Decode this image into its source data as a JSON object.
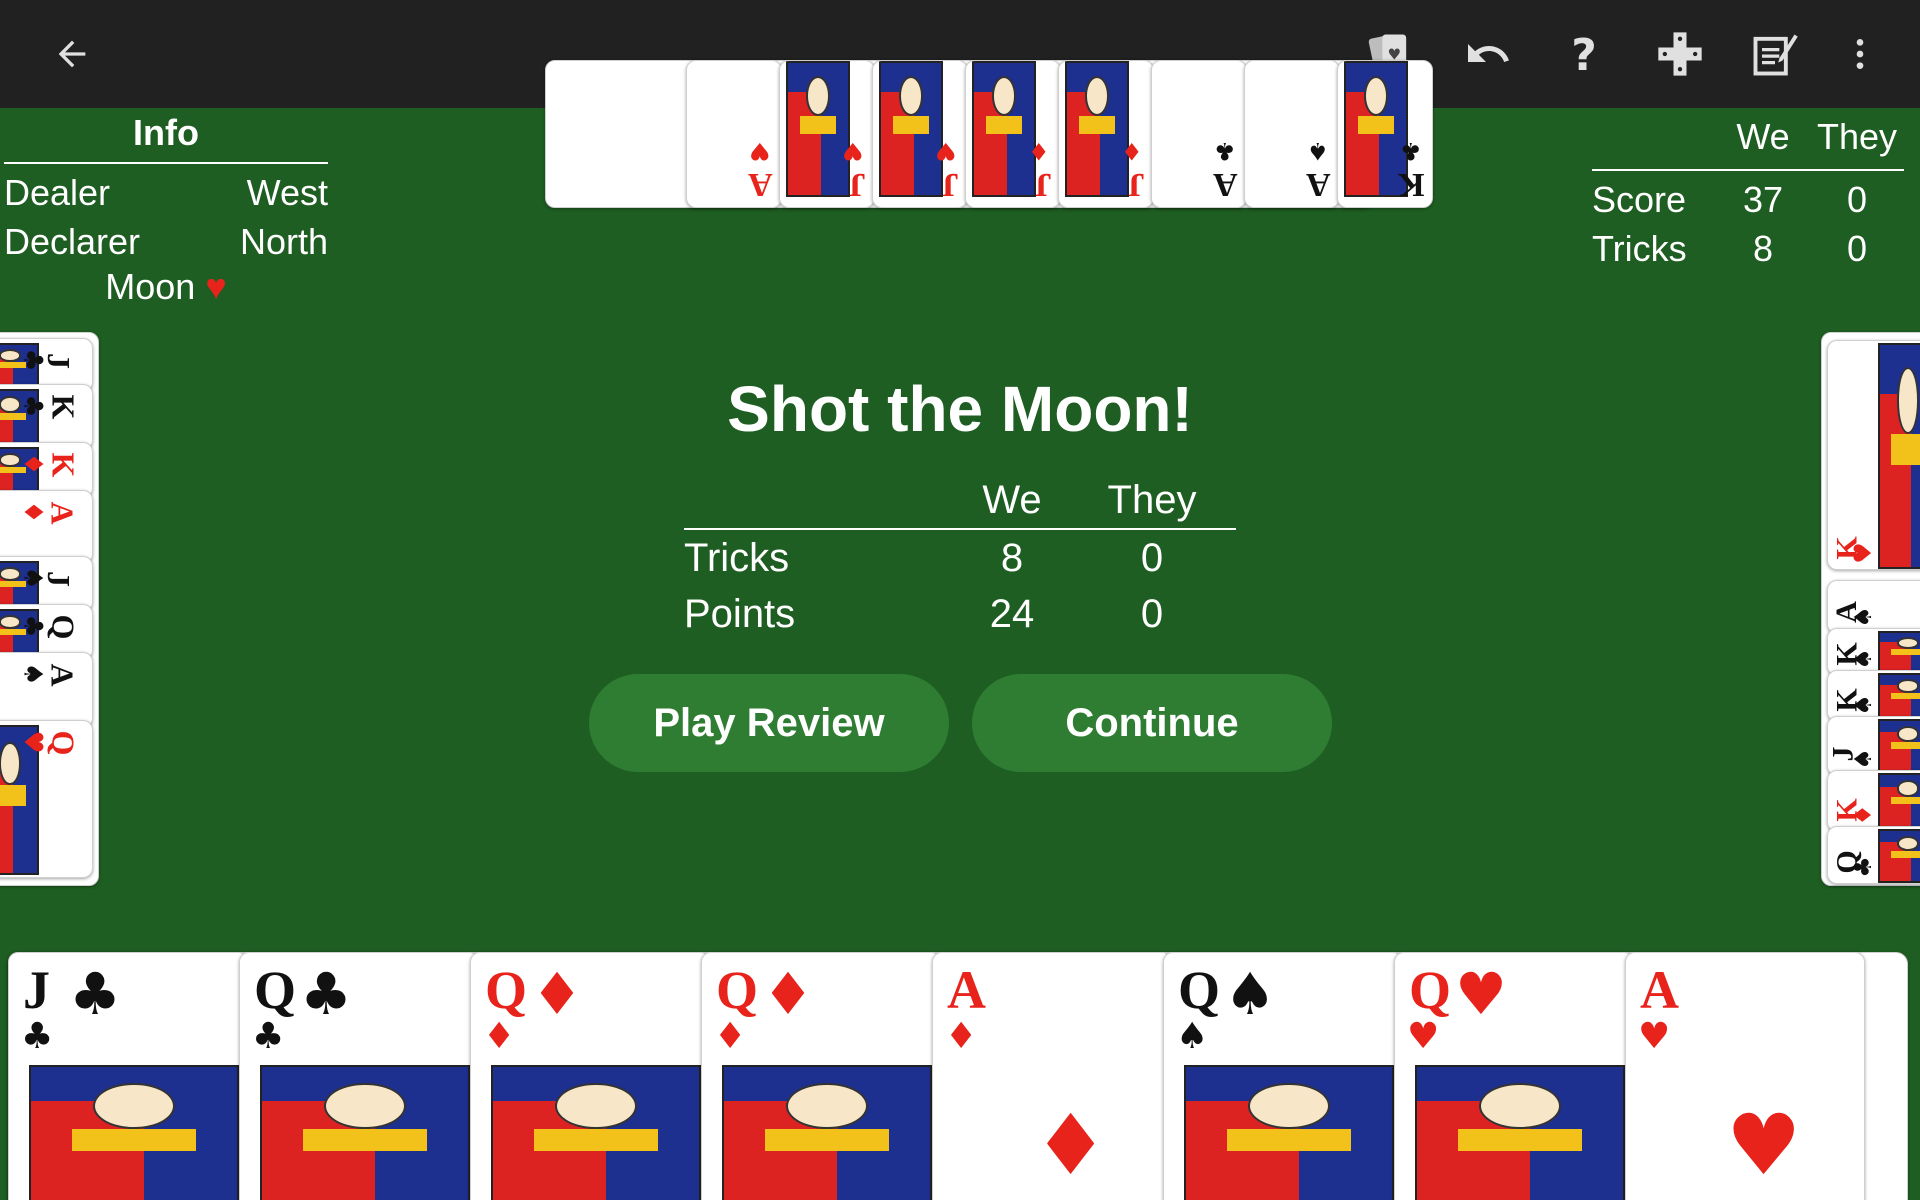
{
  "toolbar": {
    "back_icon": "arrow-left-icon",
    "icons": [
      "card-deck-icon",
      "undo-icon",
      "help-icon",
      "direction-pad-icon",
      "scoresheet-icon",
      "more-vertical-icon"
    ]
  },
  "info": {
    "title": "Info",
    "rows": [
      {
        "label": "Dealer",
        "value": "West"
      },
      {
        "label": "Declarer",
        "value": "North"
      }
    ],
    "contract": "Moon",
    "contract_suit": "♥"
  },
  "scoreboard": {
    "headers": [
      "We",
      "They"
    ],
    "rows": [
      {
        "label": "Score",
        "we": "37",
        "they": "0"
      },
      {
        "label": "Tricks",
        "we": "8",
        "they": "0"
      }
    ]
  },
  "result": {
    "title": "Shot the Moon!",
    "headers": [
      "We",
      "They"
    ],
    "rows": [
      {
        "label": "Tricks",
        "we": "8",
        "they": "0"
      },
      {
        "label": "Points",
        "we": "24",
        "they": "0"
      }
    ],
    "play_review_label": "Play Review",
    "continue_label": "Continue"
  },
  "hands": {
    "north": [
      {
        "rank": "A",
        "suit": "♥"
      },
      {
        "rank": "J",
        "suit": "♥"
      },
      {
        "rank": "J",
        "suit": "♥"
      },
      {
        "rank": "J",
        "suit": "♦"
      },
      {
        "rank": "J",
        "suit": "♦"
      },
      {
        "rank": "A",
        "suit": "♣"
      },
      {
        "rank": "A",
        "suit": "♠"
      },
      {
        "rank": "K",
        "suit": "♣"
      }
    ],
    "west": [
      {
        "rank": "J",
        "suit": "♣"
      },
      {
        "rank": "K",
        "suit": "♣"
      },
      {
        "rank": "K",
        "suit": "♦"
      },
      {
        "rank": "A",
        "suit": "♦"
      },
      {
        "rank": "J",
        "suit": "♠"
      },
      {
        "rank": "Q",
        "suit": "♣"
      },
      {
        "rank": "A",
        "suit": "♠"
      },
      {
        "rank": "Q",
        "suit": "♥"
      }
    ],
    "east": [
      {
        "rank": "K",
        "suit": "♥"
      },
      {
        "rank": "A",
        "suit": "♠"
      },
      {
        "rank": "K",
        "suit": "♠"
      },
      {
        "rank": "K",
        "suit": "♠"
      },
      {
        "rank": "J",
        "suit": "♠"
      },
      {
        "rank": "K",
        "suit": "♦"
      },
      {
        "rank": "Q",
        "suit": "♣"
      }
    ],
    "south": [
      {
        "rank": "J",
        "suit": "♣"
      },
      {
        "rank": "Q",
        "suit": "♣"
      },
      {
        "rank": "Q",
        "suit": "♦"
      },
      {
        "rank": "Q",
        "suit": "♦"
      },
      {
        "rank": "A",
        "suit": "♦"
      },
      {
        "rank": "Q",
        "suit": "♠"
      },
      {
        "rank": "Q",
        "suit": "♥"
      },
      {
        "rank": "A",
        "suit": "♥"
      }
    ]
  },
  "colors": {
    "felt": "#1e5e22",
    "toolbar": "#212121",
    "button": "#2e7d32",
    "red_suit": "#e8231b",
    "black_suit": "#111111"
  }
}
